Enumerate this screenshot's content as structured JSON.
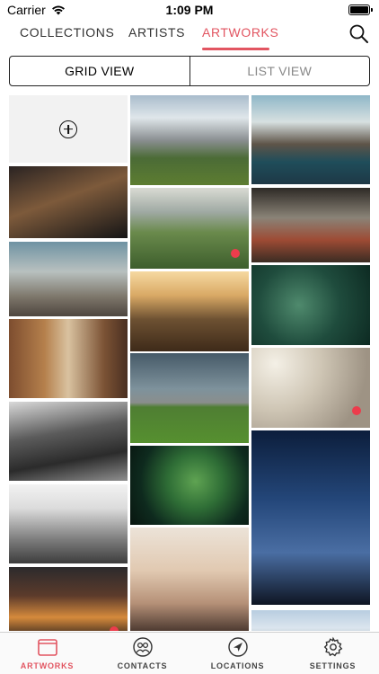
{
  "status_bar": {
    "carrier": "Carrier",
    "time": "1:09 PM",
    "wifi_icon": "wifi-icon",
    "battery_icon": "battery-icon"
  },
  "tabs": [
    {
      "label": "COLLECTIONS",
      "active": false
    },
    {
      "label": "ARTISTS",
      "active": false
    },
    {
      "label": "ARTWORKS",
      "active": true
    }
  ],
  "search_icon": "search-icon",
  "view_toggle": {
    "grid": "GRID VIEW",
    "list": "LIST VIEW",
    "selected": "grid"
  },
  "artworks": {
    "add_icon": "plus-circle-icon",
    "columns": [
      [
        {
          "subject": "night street",
          "dot": false
        },
        {
          "subject": "pebble beach",
          "dot": false
        },
        {
          "subject": "balconies",
          "dot": false
        },
        {
          "subject": "train window",
          "dot": false
        },
        {
          "subject": "power lines",
          "dot": false
        },
        {
          "subject": "city traffic at night",
          "dot": true
        }
      ],
      [
        {
          "subject": "mountain valley",
          "dot": false
        },
        {
          "subject": "green hills",
          "dot": true
        },
        {
          "subject": "cliff at sunset",
          "dot": false
        },
        {
          "subject": "storm over field",
          "dot": false
        },
        {
          "subject": "green plant",
          "dot": false
        },
        {
          "subject": "hazy city person",
          "dot": false
        }
      ],
      [
        {
          "subject": "rocky coast",
          "dot": false
        },
        {
          "subject": "station roof",
          "dot": false
        },
        {
          "subject": "fern leaves",
          "dot": false
        },
        {
          "subject": "birds in fog",
          "dot": true
        },
        {
          "subject": "milky way",
          "dot": false
        },
        {
          "subject": "city skyline",
          "dot": false
        }
      ]
    ]
  },
  "colors": {
    "accent": "#e25561",
    "dot": "#ec3c4c"
  },
  "tabbar": [
    {
      "label": "ARTWORKS",
      "icon": "artworks-icon",
      "active": true
    },
    {
      "label": "CONTACTS",
      "icon": "contacts-icon",
      "active": false
    },
    {
      "label": "LOCATIONS",
      "icon": "location-arrow-icon",
      "active": false
    },
    {
      "label": "SETTINGS",
      "icon": "gear-icon",
      "active": false
    }
  ]
}
